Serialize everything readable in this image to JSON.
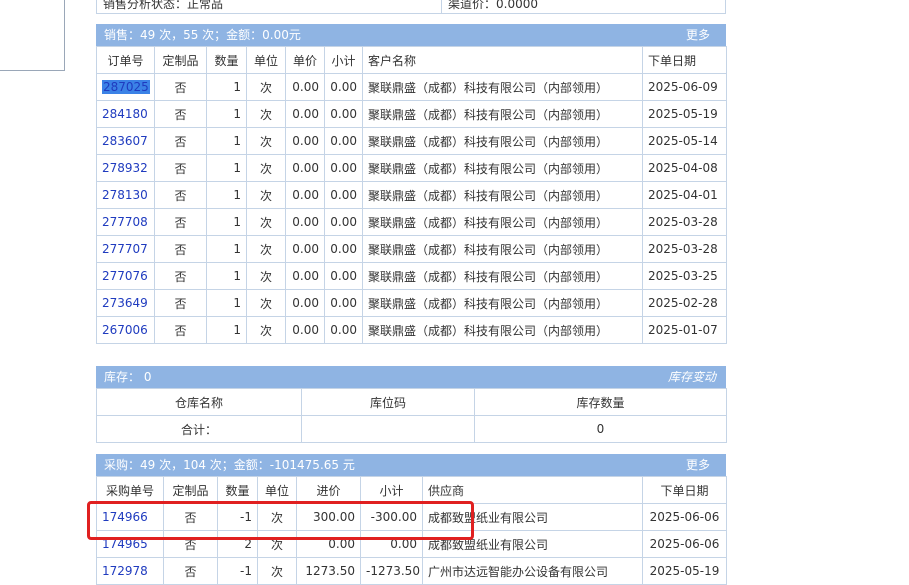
{
  "top": {
    "status": "销售分析状态：正常品",
    "channel": "渠道价：0.0000"
  },
  "sales": {
    "summary": "销售：49 次，55 次；金额：0.00元",
    "more": "更多",
    "columns": [
      "订单号",
      "定制品",
      "数量",
      "单位",
      "单价",
      "小计",
      "客户名称",
      "下单日期"
    ],
    "rows": [
      [
        "287025",
        "否",
        "1",
        "次",
        "0.00",
        "0.00",
        "聚联鼎盛（成都）科技有限公司（内部领用）",
        "2025-06-09"
      ],
      [
        "284180",
        "否",
        "1",
        "次",
        "0.00",
        "0.00",
        "聚联鼎盛（成都）科技有限公司（内部领用）",
        "2025-05-19"
      ],
      [
        "283607",
        "否",
        "1",
        "次",
        "0.00",
        "0.00",
        "聚联鼎盛（成都）科技有限公司（内部领用）",
        "2025-05-14"
      ],
      [
        "278932",
        "否",
        "1",
        "次",
        "0.00",
        "0.00",
        "聚联鼎盛（成都）科技有限公司（内部领用）",
        "2025-04-08"
      ],
      [
        "278130",
        "否",
        "1",
        "次",
        "0.00",
        "0.00",
        "聚联鼎盛（成都）科技有限公司（内部领用）",
        "2025-04-01"
      ],
      [
        "277708",
        "否",
        "1",
        "次",
        "0.00",
        "0.00",
        "聚联鼎盛（成都）科技有限公司（内部领用）",
        "2025-03-28"
      ],
      [
        "277707",
        "否",
        "1",
        "次",
        "0.00",
        "0.00",
        "聚联鼎盛（成都）科技有限公司（内部领用）",
        "2025-03-28"
      ],
      [
        "277076",
        "否",
        "1",
        "次",
        "0.00",
        "0.00",
        "聚联鼎盛（成都）科技有限公司（内部领用）",
        "2025-03-25"
      ],
      [
        "273649",
        "否",
        "1",
        "次",
        "0.00",
        "0.00",
        "聚联鼎盛（成都）科技有限公司（内部领用）",
        "2025-02-28"
      ],
      [
        "267006",
        "否",
        "1",
        "次",
        "0.00",
        "0.00",
        "聚联鼎盛（成都）科技有限公司（内部领用）",
        "2025-01-07"
      ]
    ]
  },
  "stock": {
    "summary": "库存： 0",
    "change": "库存变动",
    "columns": [
      "仓库名称",
      "库位码",
      "库存数量"
    ],
    "total_label": "合计：",
    "total_value": "0"
  },
  "purchase": {
    "summary": "采购：49 次，104 次；金额：-101475.65 元",
    "more": "更多",
    "columns": [
      "采购单号",
      "定制品",
      "数量",
      "单位",
      "进价",
      "小计",
      "供应商",
      "下单日期"
    ],
    "rows": [
      [
        "174966",
        "否",
        "-1",
        "次",
        "300.00",
        "-300.00",
        "成都致盟纸业有限公司",
        "2025-06-06"
      ],
      [
        "174965",
        "否",
        "2",
        "次",
        "0.00",
        "0.00",
        "成都致盟纸业有限公司",
        "2025-06-06"
      ],
      [
        "172978",
        "否",
        "-1",
        "次",
        "1273.50",
        "-1273.50",
        "广州市达远智能办公设备有限公司",
        "2025-05-19"
      ]
    ]
  }
}
